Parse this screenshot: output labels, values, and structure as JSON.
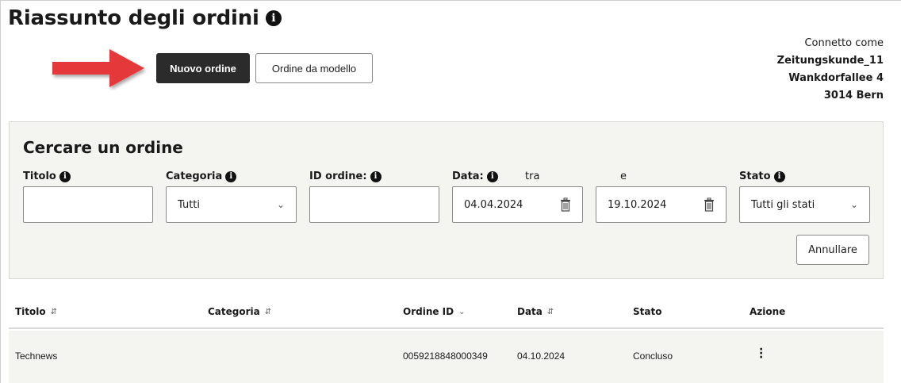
{
  "page": {
    "title": "Riassunto degli ordini"
  },
  "toolbar": {
    "new_order": "Nuovo ordine",
    "from_template": "Ordine da modello"
  },
  "user": {
    "label": "Connetto come",
    "name": "Zeitungskunde_11",
    "street": "Wankdorfallee 4",
    "city": "3014 Bern"
  },
  "search": {
    "heading": "Cercare un ordine",
    "labels": {
      "title": "Titolo",
      "category": "Categoria",
      "order_id": "ID ordine:",
      "date": "Data:",
      "between": "tra",
      "and": "e",
      "status": "Stato"
    },
    "values": {
      "title": "",
      "category": "Tutti",
      "order_id": "",
      "date_from": "04.04.2024",
      "date_to": "19.10.2024",
      "status": "Tutti gli stati"
    },
    "cancel": "Annullare"
  },
  "table": {
    "headers": [
      "Titolo",
      "Categoria",
      "Ordine ID",
      "Data",
      "Stato",
      "Azione"
    ],
    "rows": [
      {
        "title": "Technews",
        "category": "",
        "order_id": "0059218848000349",
        "date": "04.10.2024",
        "status": "Concluso"
      }
    ]
  },
  "colors": {
    "primary": "#2b2b2b",
    "panel": "#f4f4f1",
    "arrow": "#e5383b"
  }
}
